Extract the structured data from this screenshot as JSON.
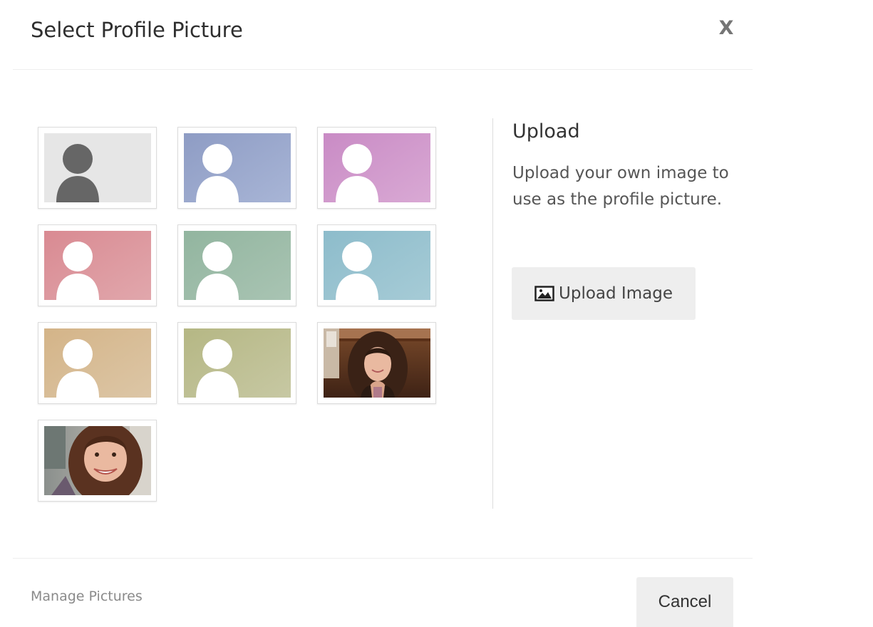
{
  "dialog": {
    "title": "Select Profile Picture",
    "close_label": "X"
  },
  "pictures": [
    {
      "kind": "default-avatar",
      "bg_from": "#e6e6e6",
      "bg_to": "#e6e6e6",
      "figure": "#666666",
      "selected": false
    },
    {
      "kind": "default-avatar",
      "bg_from": "#8e9cc4",
      "bg_to": "#a8b5d6",
      "figure": "#ffffff",
      "selected": false
    },
    {
      "kind": "default-avatar",
      "bg_from": "#c98bc5",
      "bg_to": "#d9a9d4",
      "figure": "#ffffff",
      "selected": false
    },
    {
      "kind": "default-avatar",
      "bg_from": "#d98a92",
      "bg_to": "#e1a7ac",
      "figure": "#ffffff",
      "selected": false
    },
    {
      "kind": "default-avatar",
      "bg_from": "#92b59f",
      "bg_to": "#a9c4b3",
      "figure": "#ffffff",
      "selected": false
    },
    {
      "kind": "default-avatar",
      "bg_from": "#8dbccb",
      "bg_to": "#a6cbd6",
      "figure": "#ffffff",
      "selected": false
    },
    {
      "kind": "default-avatar",
      "bg_from": "#d4b488",
      "bg_to": "#dcc6a6",
      "figure": "#ffffff",
      "selected": false
    },
    {
      "kind": "default-avatar",
      "bg_from": "#b5b784",
      "bg_to": "#c7c8a3",
      "figure": "#ffffff",
      "selected": false
    },
    {
      "kind": "photo",
      "subject": "woman-portrait-indoor",
      "selected": false
    },
    {
      "kind": "photo",
      "subject": "woman-selfie-smiling",
      "selected": false
    }
  ],
  "upload": {
    "heading": "Upload",
    "description": "Upload your own image to use as the profile picture.",
    "button_label": "Upload Image",
    "button_icon": "image-icon"
  },
  "footer": {
    "manage_label": "Manage Pictures",
    "cancel_label": "Cancel"
  }
}
